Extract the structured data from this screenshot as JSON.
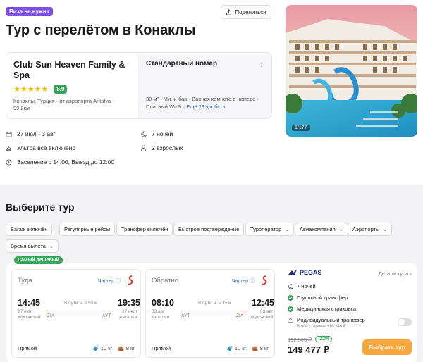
{
  "header": {
    "visa_badge": "Виза не нужна",
    "share_label": "Поделиться",
    "title": "Тур с перелётом в Конаклы"
  },
  "hotel": {
    "name": "Club Sun Heaven Family & Spa",
    "stars": "★★★★★",
    "rating": "8.9",
    "location": "Конаклы, Турция · от аэропорта Antalya - 99.2км"
  },
  "room": {
    "name": "Стандартный номер",
    "features": "30 м² · Мини-бар · Ванная комната в номере · Платный Wi-Fi ·",
    "more": "Ещё 28 удобств"
  },
  "photo": {
    "counter": "1/177"
  },
  "trip_info": {
    "dates": "27 июл - 3 авг",
    "nights": "7 ночей",
    "meal": "Ультра всё включено",
    "guests": "2 взрослых",
    "checkin": "Заселение с 14:00, Выезд до 12:00"
  },
  "choose_title": "Выберите тур",
  "filters": [
    "Багаж включён",
    "Регулярные рейсы",
    "Трансфер включён",
    "Быстрое подтверждение",
    "Туроператор",
    "Авиакомпания",
    "Аэропорты",
    "Время вылета"
  ],
  "tour": {
    "cheap_badge": "Самый дешёвый",
    "outbound": {
      "title": "Туда",
      "charter": "Чартер",
      "dep_time": "14:45",
      "dep_date": "27 июл",
      "dep_city": "Жуковский",
      "arr_time": "19:35",
      "arr_date": "27 июл",
      "arr_city": "Анталья",
      "duration": "В пути: 4 ч 50 м",
      "dep_code": "ZIA",
      "arr_code": "AYT",
      "type": "Прямой",
      "bag1": "10 кг",
      "bag2": "8 кг"
    },
    "return": {
      "title": "Обратно",
      "charter": "Чартер",
      "dep_time": "08:10",
      "dep_date": "03 авг",
      "dep_city": "Анталья",
      "arr_time": "12:45",
      "arr_date": "03 авг",
      "arr_city": "Жуковский",
      "duration": "В пути: 4 ч 35 м",
      "dep_code": "AYT",
      "arr_code": "ZIA",
      "type": "Прямой",
      "bag1": "10 кг",
      "bag2": "8 кг"
    },
    "operator": "PEGAS",
    "details_link": "Детали тура",
    "nights": "7 ночей",
    "group_transfer": "Групповой трансфер",
    "insurance": "Медицинская страховка",
    "individual_transfer": "Индивидуальный трансфер",
    "individual_transfer_note": "В обе стороны +16 340 ₽",
    "old_price": "192 505 ₽",
    "discount": "-22%",
    "price": "149 477 ₽",
    "book_label": "Выбрать тур"
  }
}
